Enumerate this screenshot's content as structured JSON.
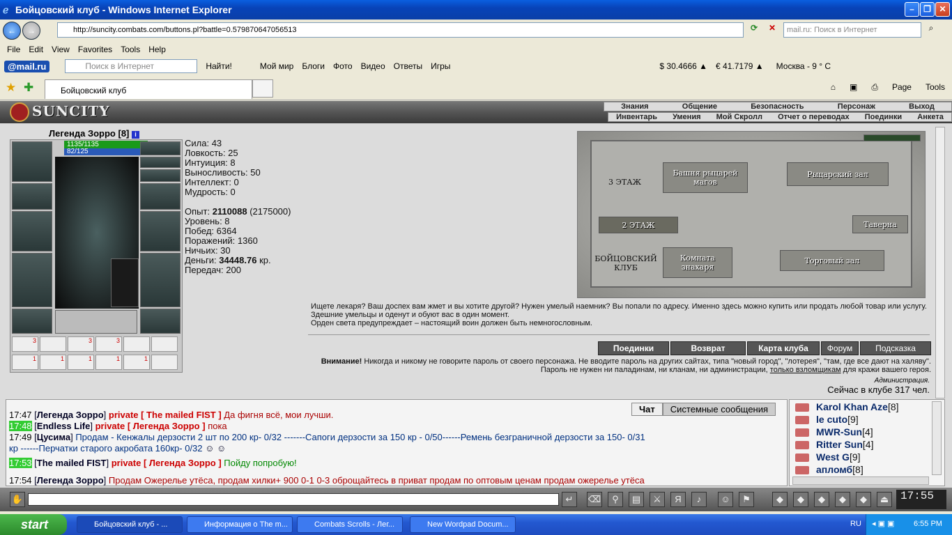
{
  "window": {
    "title": "Бойцовский клуб - Windows Internet Explorer"
  },
  "address": {
    "url": "http://suncity.combats.com/buttons.pl?battle=0.579870647056513",
    "search_placeholder": "mail.ru: Поиск в Интернет"
  },
  "menu": [
    "File",
    "Edit",
    "View",
    "Favorites",
    "Tools",
    "Help"
  ],
  "mailbar": {
    "logo": "@mail.ru",
    "search_placeholder": "Поиск в Интернет",
    "find": "Найти!",
    "items": [
      "Мой мир",
      "Блоги",
      "Фото",
      "Видео",
      "Ответы",
      "Игры"
    ],
    "usd": "$ 30.4666 ▲",
    "eur": "€ 41.7179 ▲",
    "weather": "Москва - 9 ° C"
  },
  "tab": {
    "label": "Бойцовский клуб",
    "page": "Page",
    "tools": "Tools"
  },
  "game": {
    "logo": "SUNCITY",
    "nav1": [
      "Знания",
      "Общение",
      "Безопасность",
      "Персонаж",
      "Выход"
    ],
    "nav2": [
      "Инвентарь",
      "Умения",
      "Мой Скролл",
      "Отчет о переводах",
      "Поединки",
      "Анкета"
    ],
    "char": {
      "name": "Легенда Зорро",
      "level": "[8]",
      "hp": "1135/1135",
      "mp": "82/125"
    },
    "stats": [
      "Сила: 43",
      "Ловкость: 25",
      "Интуиция: 8",
      "Выносливость: 50",
      "Интеллект: 0",
      "Мудрость: 0"
    ],
    "exp": {
      "label": "Опыт: ",
      "value": "2110088",
      "next": " (2175000)"
    },
    "stats2": [
      "Уровень: 8",
      "Побед: 6364",
      "Поражений: 1360",
      "Ничьих: 30"
    ],
    "money": {
      "label": "Деньги: ",
      "value": "34448.76",
      "unit": " кр."
    },
    "transfers": "Передач: 200",
    "scrolls": [
      "3",
      "",
      "3",
      "3",
      "",
      "",
      "1",
      "1",
      "1",
      "1",
      "1",
      ""
    ],
    "map": {
      "floor3": "3 ЭТАЖ",
      "floor2": "2 ЭТАЖ",
      "club": "БОЙЦОВСКИЙ КЛУБ",
      "tower": "Башня рыцарей магов",
      "hall": "Рыцарский зал",
      "tavern": "Таверна",
      "healer": "Комната знахаря",
      "shop": "Торговый зал"
    },
    "desc1": "Ищете лекаря? Ваш доспех вам жмет и вы хотите другой? Нужен умелый наемник? Вы попали по адресу. Именно здесь можно купить или продать любой товар или услугу. Здешние умельцы и оденут и обуют вас в один момент.",
    "desc2": "Орден света предупреждает – настоящий воин должен быть немногословным.",
    "buttons": [
      "Поединки",
      "Возврат",
      "Карта клуба",
      "Форум",
      "Подсказка"
    ],
    "warn_label": "Внимание!",
    "warn": " Никогда и никому не говорите пароль от своего персонажа. Не вводите пароль на других сайтах, типа \"новый город\", \"лотерея\", \"там, где все дают на халяву\". Пароль не нужен ни паладинам, ни кланам, ни администрации, ",
    "warn_link": "только взломщикам",
    "warn_end": " для кражи вашего героя.",
    "admin": "Администрация.",
    "online": "Сейчас в клубе 317 чел."
  },
  "chat": {
    "tabs": [
      "Чат",
      "Системные сообщения"
    ],
    "lines": [
      {
        "ts": "17:47",
        "nick": "Легенда Зорро",
        "priv": "private [ The mailed FIST ]",
        "text": " Да фигня всё, мои лучши."
      },
      {
        "ts": "17:48",
        "nick": "Endless Life",
        "priv": "private [ Легенда Зорро ]",
        "text": " пока"
      },
      {
        "ts": "17:49",
        "nick": "Цусима",
        "priv": "",
        "text": " Продам - Кенжалы дерзости 2 шт по 200 кр- 0/32 -------Сапоги дерзости за 150 кр - 0/50------Ремень безграничной дерзости за 150- 0/31"
      },
      {
        "ts": "",
        "nick": "",
        "priv": "",
        "text": "кр ------Перчатки старого акробата 160кр- 0/32"
      },
      {
        "ts": "17:53",
        "nick": "The mailed FIST",
        "priv": "private [ Легенда Зорро ]",
        "text": " Пойду попробую!"
      },
      {
        "ts": "17:54",
        "nick": "Легенда Зорро",
        "priv": "",
        "text": " Продам Ожерелье утёса, продам хилки+ 900 0-1 0-3 оброщайтесь в приват продам по оптовым ценам     продам ожерелье утёса"
      }
    ]
  },
  "users": [
    {
      "name": "Karol Khan Aze",
      "lv": "[8]"
    },
    {
      "name": "le cuto",
      "lv": "[9]"
    },
    {
      "name": "MWR-Sun",
      "lv": "[4]"
    },
    {
      "name": "Ritter Sun",
      "lv": "[4]"
    },
    {
      "name": "West G",
      "lv": "[9]"
    },
    {
      "name": "апломб",
      "lv": "[8]"
    }
  ],
  "clock": "17:55",
  "taskbar": {
    "start": "start",
    "tasks": [
      "Бойцовский клуб - ...",
      "Информация о The m...",
      "Combats Scrolls - Лег...",
      "New Wordpad Docum..."
    ],
    "lang": "RU",
    "time": "6:55 PM"
  }
}
